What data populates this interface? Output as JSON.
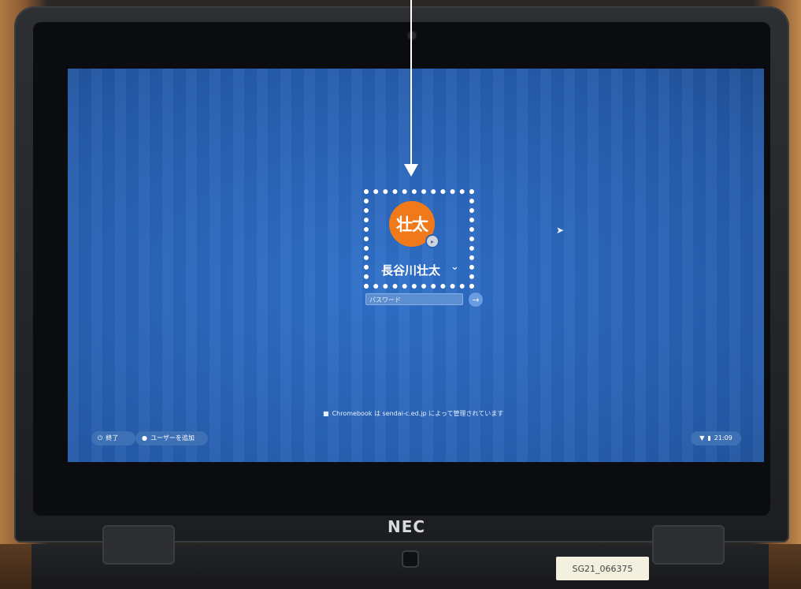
{
  "photo": {
    "brand": "NEC",
    "serial_label": "SG21_066375"
  },
  "login": {
    "avatar_initials": "壮太",
    "username": "長谷川壮太",
    "password_placeholder": "パスワード",
    "managed_notice": "Chromebook は sendai-c.ed.jp によって管理されています"
  },
  "shelf": {
    "power_label": "終了",
    "add_user_label": "ユーザーを追加",
    "clock": "21:09"
  },
  "colors": {
    "screen_blue": "#2a64b8",
    "avatar_orange": "#f07a1a",
    "highlight": "#ffffff"
  },
  "icons": {
    "power": "power-icon",
    "add_user": "add-user-icon",
    "wifi": "wifi-icon",
    "battery": "battery-icon",
    "submit": "arrow-right-icon",
    "managed": "building-icon",
    "cursor": "mouse-pointer-icon",
    "dropdown": "chevron-down-icon"
  }
}
